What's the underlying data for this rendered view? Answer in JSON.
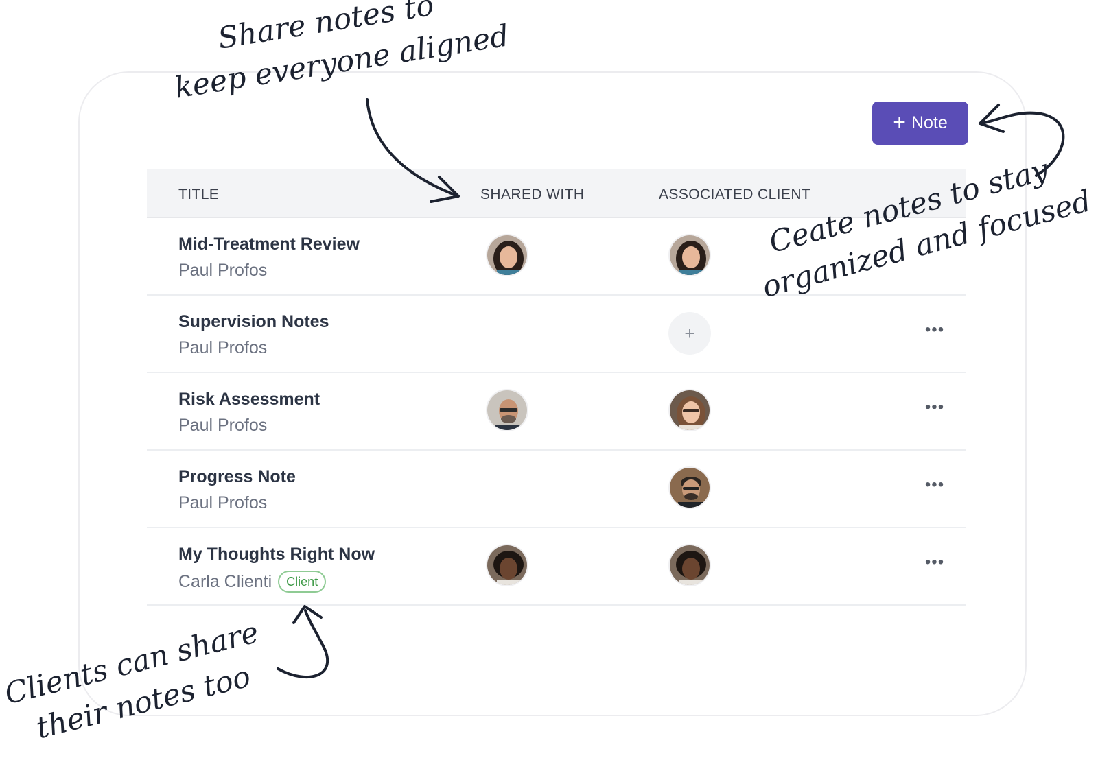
{
  "toolbar": {
    "add_note_label": "Note"
  },
  "table": {
    "headers": {
      "title": "TITLE",
      "shared_with": "SHARED WITH",
      "associated_client": "ASSOCIATED CLIENT"
    },
    "rows": [
      {
        "title": "Mid-Treatment Review",
        "author": "Paul Profos",
        "badge": ""
      },
      {
        "title": "Supervision Notes",
        "author": "Paul Profos",
        "badge": ""
      },
      {
        "title": "Risk Assessment",
        "author": "Paul Profos",
        "badge": ""
      },
      {
        "title": "Progress Note",
        "author": "Paul Profos",
        "badge": ""
      },
      {
        "title": "My Thoughts Right Now",
        "author": "Carla Clienti",
        "badge": "Client"
      }
    ]
  },
  "annotations": {
    "top_line1": "Share notes to",
    "top_line2": "keep everyone aligned",
    "right_line1": "Ceate notes to stay",
    "right_line2": "organized and focused",
    "bottom_line1": "Clients can share",
    "bottom_line2": "their notes too"
  },
  "colors": {
    "accent": "#5a4db6",
    "client_badge": "#3f9a48",
    "header_bg": "#f3f4f6"
  }
}
